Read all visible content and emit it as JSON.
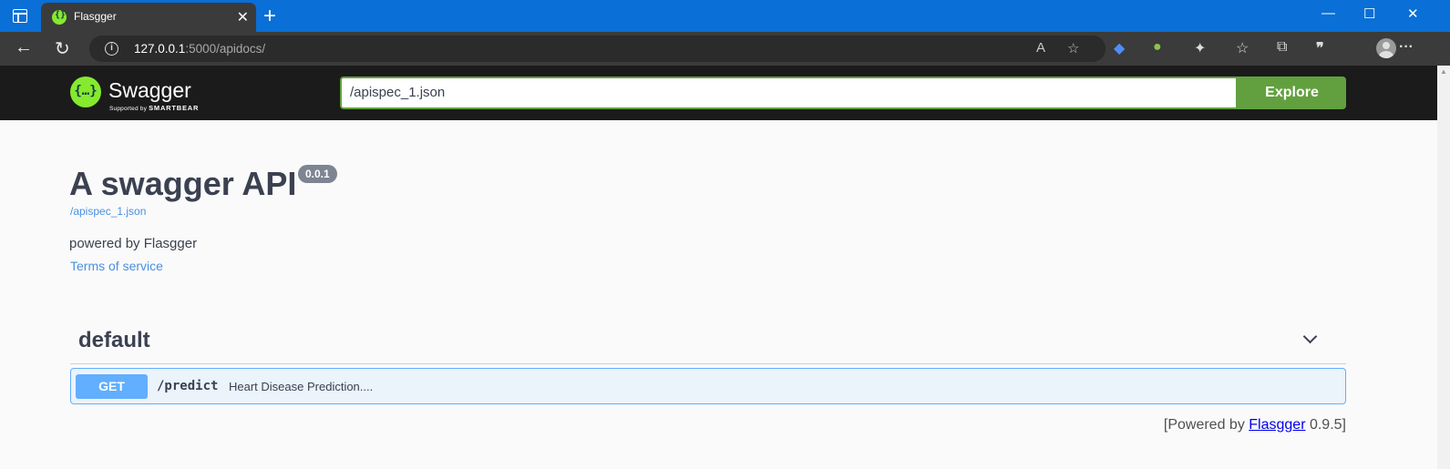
{
  "browser": {
    "tab_title": "Flasgger",
    "url_host": "127.0.0.1",
    "url_rest": ":5000/apidocs/",
    "controls": {
      "new_tab": "+",
      "close_tab": "✕",
      "minimize": "—",
      "maximize": "☐",
      "close": "✕"
    }
  },
  "swagger_bar": {
    "brand": "Swagger",
    "supported_prefix": "Supported by",
    "supported_brand": "SMARTBEAR",
    "spec_input_value": "/apispec_1.json",
    "explore_label": "Explore"
  },
  "info": {
    "title": "A swagger API",
    "version": "0.0.1",
    "spec_link": "/apispec_1.json",
    "description": "powered by Flasgger",
    "terms_link": "Terms of service"
  },
  "operations": {
    "tag": "default",
    "items": [
      {
        "method": "GET",
        "path": "/predict",
        "summary": "Heart Disease Prediction...."
      }
    ]
  },
  "footer": {
    "prefix": "[Powered by ",
    "link": "Flasgger",
    "suffix": " 0.9.5]"
  },
  "colors": {
    "titlebar": "#0a6fd6",
    "swagger_green": "#85ea2d",
    "explore_green": "#62a03f",
    "get_blue": "#61affe"
  }
}
